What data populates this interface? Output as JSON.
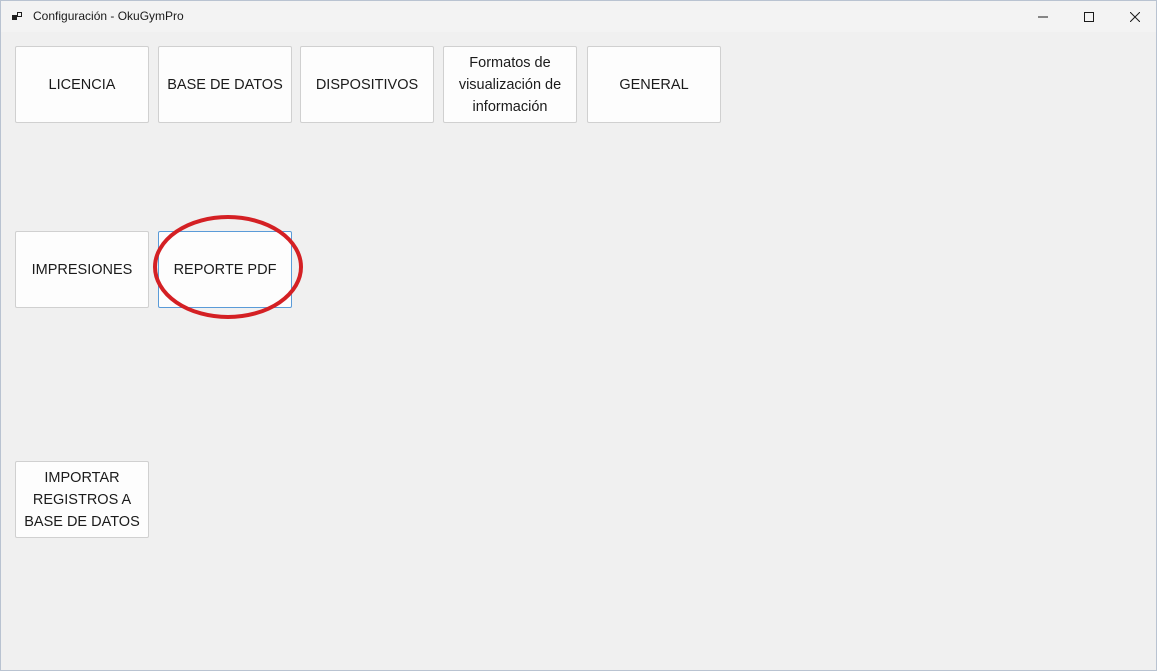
{
  "window": {
    "title": "Configuración - OkuGymPro"
  },
  "caption_buttons": {
    "minimize": "minimize",
    "maximize": "maximize",
    "close": "close"
  },
  "tiles": {
    "licencia": "LICENCIA",
    "base_de_datos": "BASE DE DATOS",
    "dispositivos": "DISPOSITIVOS",
    "formatos": "Formatos de visualización de información",
    "general": "GENERAL",
    "impresiones": "IMPRESIONES",
    "reporte_pdf": "REPORTE PDF",
    "importar": "IMPORTAR REGISTROS A BASE DE DATOS"
  },
  "annotation": {
    "highlight_color": "#d42024",
    "highlighted_item": "REPORTE PDF"
  }
}
